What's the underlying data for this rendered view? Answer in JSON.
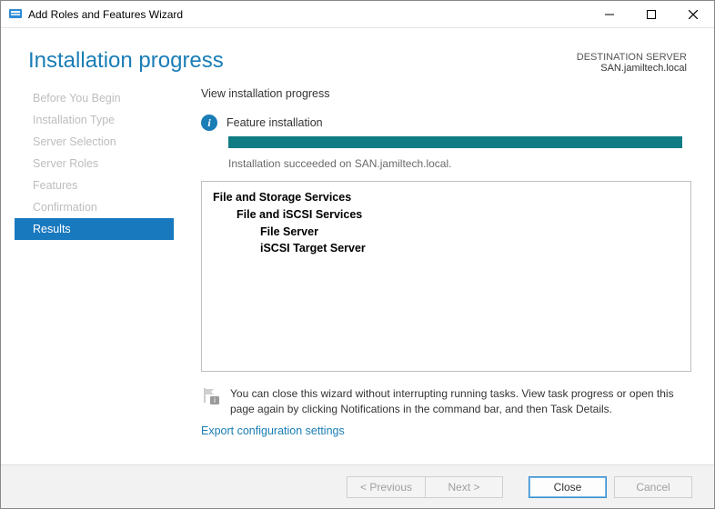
{
  "window": {
    "title": "Add Roles and Features Wizard"
  },
  "header": {
    "pageTitle": "Installation progress",
    "destLabel": "DESTINATION SERVER",
    "destServer": "SAN.jamiltech.local"
  },
  "sidebar": {
    "steps": [
      {
        "label": "Before You Begin"
      },
      {
        "label": "Installation Type"
      },
      {
        "label": "Server Selection"
      },
      {
        "label": "Server Roles"
      },
      {
        "label": "Features"
      },
      {
        "label": "Confirmation"
      },
      {
        "label": "Results"
      }
    ],
    "activeIndex": 6
  },
  "main": {
    "subtitle": "View installation progress",
    "statusTitle": "Feature installation",
    "progressPercent": 100,
    "succeededText": "Installation succeeded on SAN.jamiltech.local.",
    "details": {
      "l0": "File and Storage Services",
      "l1": "File and iSCSI Services",
      "l2a": "File Server",
      "l2b": "iSCSI Target Server"
    },
    "hintText": "You can close this wizard without interrupting running tasks. View task progress or open this page again by clicking Notifications in the command bar, and then Task Details.",
    "exportLink": "Export configuration settings"
  },
  "buttons": {
    "previous": "< Previous",
    "next": "Next >",
    "close": "Close",
    "cancel": "Cancel"
  }
}
